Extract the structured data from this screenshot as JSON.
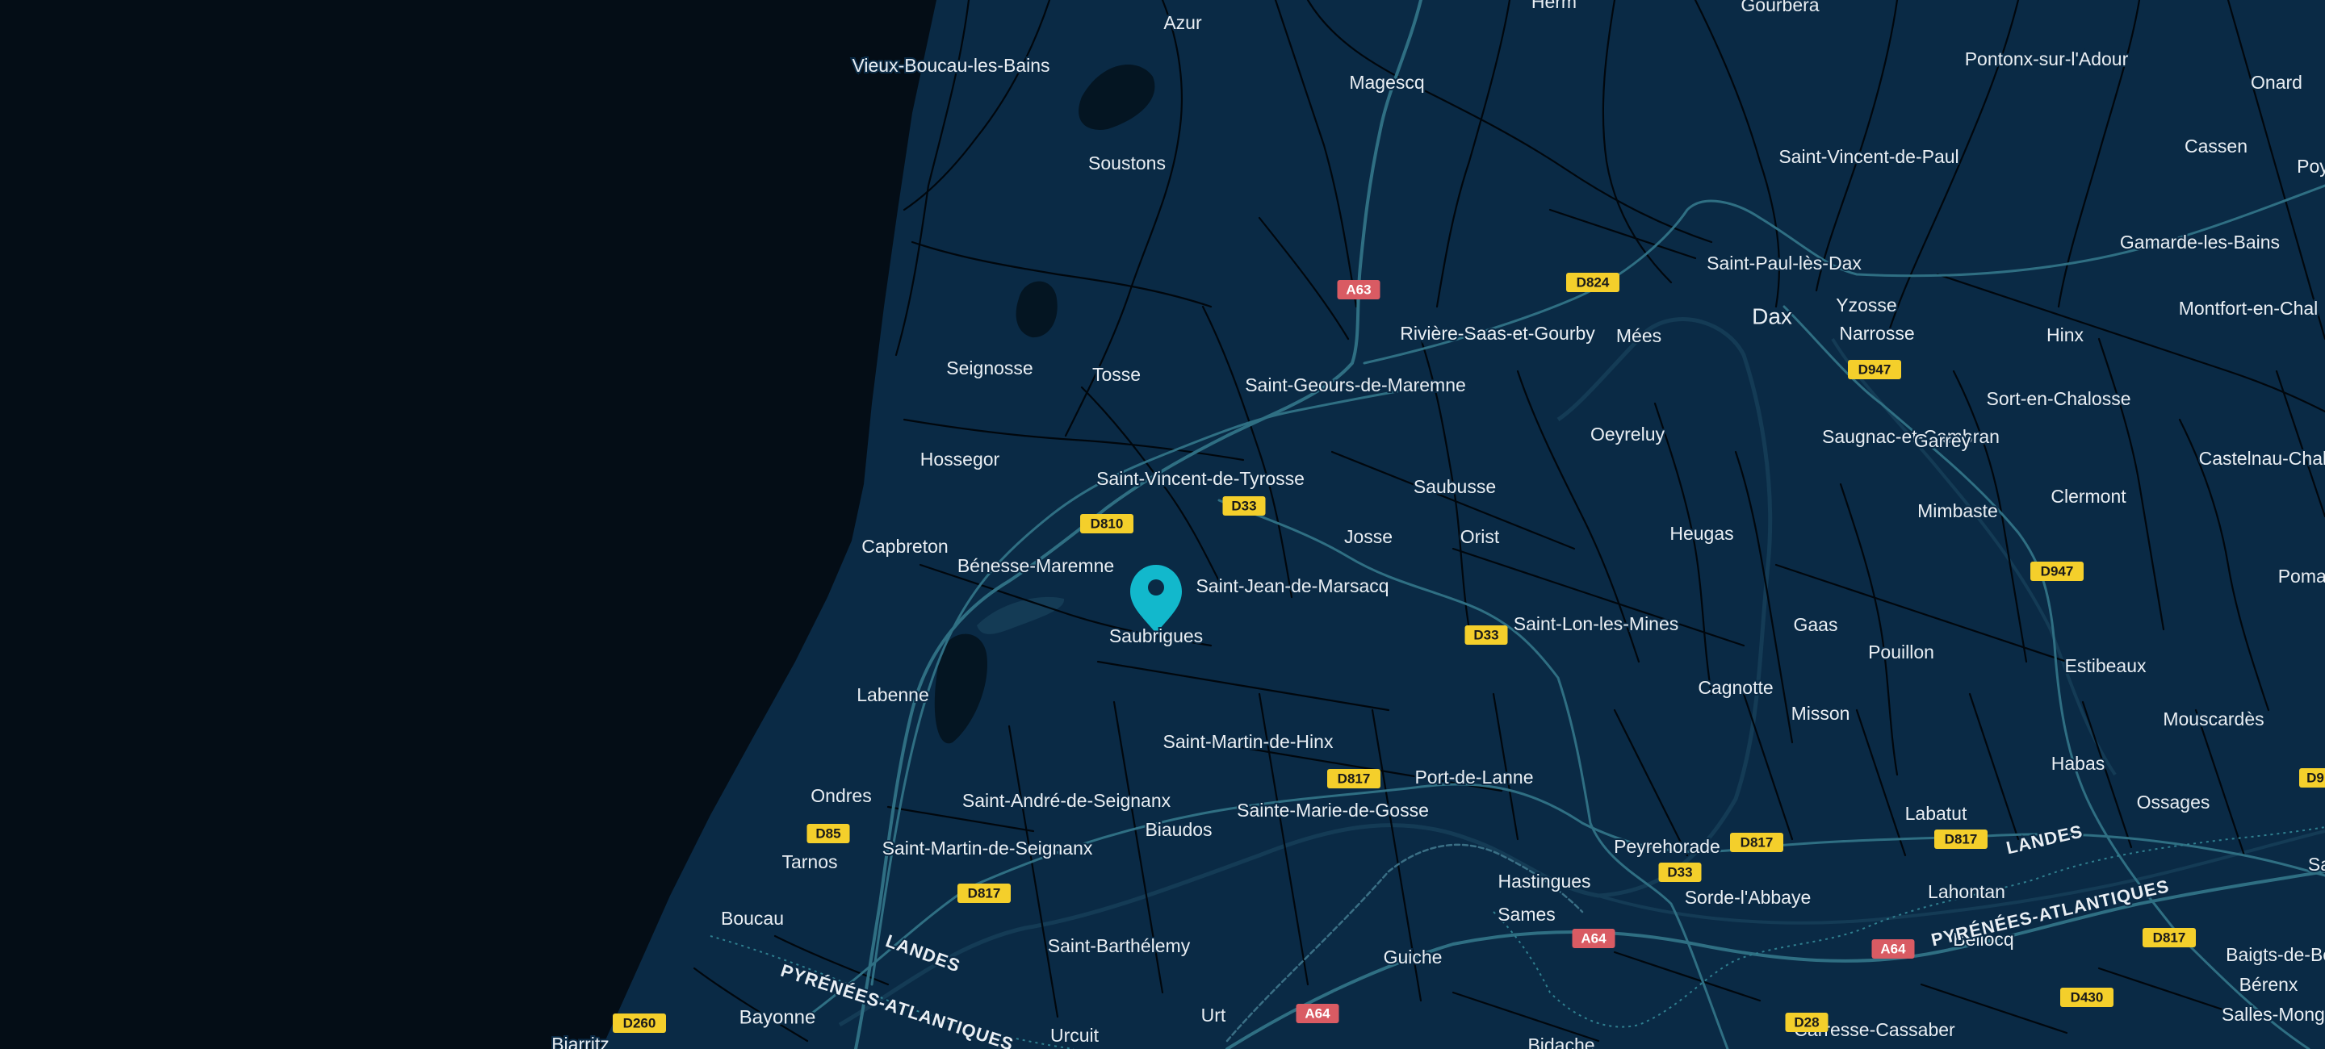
{
  "map": {
    "colors": {
      "ocean": "#040d16",
      "land": "#0a2a45",
      "road": "#01070d",
      "highway": "#2f6f83",
      "water": "#143b55",
      "pin": "#12b8cc",
      "d_shield": "#f4cf2b",
      "a_shield": "#d95b63"
    },
    "pin": {
      "icon": "map-pin-icon",
      "label": "Saubrigues"
    },
    "places": [
      {
        "name": "Herm"
      },
      {
        "name": "Gourbera"
      },
      {
        "name": "Azur"
      },
      {
        "name": "Pontonx-sur-l'Adour"
      },
      {
        "name": "Onard"
      },
      {
        "name": "Vieux-Boucau-les-Bains"
      },
      {
        "name": "Magescq"
      },
      {
        "name": "Cassen"
      },
      {
        "name": "Poy"
      },
      {
        "name": "Soustons"
      },
      {
        "name": "Saint-Vincent-de-Paul"
      },
      {
        "name": "Gamarde-les-Bains"
      },
      {
        "name": "Saint-Paul-lès-Dax"
      },
      {
        "name": "Dax"
      },
      {
        "name": "Yzosse"
      },
      {
        "name": "Montfort-en-Chal"
      },
      {
        "name": "Rivière-Saas-et-Gourby"
      },
      {
        "name": "Mées"
      },
      {
        "name": "Narrosse"
      },
      {
        "name": "Hinx"
      },
      {
        "name": "Seignosse"
      },
      {
        "name": "Tosse"
      },
      {
        "name": "Saint-Geours-de-Maremne"
      },
      {
        "name": "Sort-en-Chalosse"
      },
      {
        "name": "Oeyreluy"
      },
      {
        "name": "Saugnac-et-Cambran"
      },
      {
        "name": "Garrey"
      },
      {
        "name": "Castelnau-Chalos"
      },
      {
        "name": "Hossegor"
      },
      {
        "name": "Saint-Vincent-de-Tyrosse"
      },
      {
        "name": "Saubusse"
      },
      {
        "name": "Clermont"
      },
      {
        "name": "Mimbaste"
      },
      {
        "name": "Josse"
      },
      {
        "name": "Orist"
      },
      {
        "name": "Heugas"
      },
      {
        "name": "Capbreton"
      },
      {
        "name": "Bénesse-Maremne"
      },
      {
        "name": "Pomare"
      },
      {
        "name": "Saint-Jean-de-Marsacq"
      },
      {
        "name": "Saint-Lon-les-Mines"
      },
      {
        "name": "Gaas"
      },
      {
        "name": "Pouillon"
      },
      {
        "name": "Estibeaux"
      },
      {
        "name": "Labenne"
      },
      {
        "name": "Cagnotte"
      },
      {
        "name": "Misson"
      },
      {
        "name": "Mouscardès"
      },
      {
        "name": "Saint-Martin-de-Hinx"
      },
      {
        "name": "Habas"
      },
      {
        "name": "Port-de-Lanne"
      },
      {
        "name": "Ondres"
      },
      {
        "name": "Saint-André-de-Seignanx"
      },
      {
        "name": "Sainte-Marie-de-Gosse"
      },
      {
        "name": "Ossages"
      },
      {
        "name": "Labatut"
      },
      {
        "name": "Biaudos"
      },
      {
        "name": "Tarnos"
      },
      {
        "name": "Saint-Martin-de-Seignanx"
      },
      {
        "name": "Peyrehorade"
      },
      {
        "name": "Hastingues"
      },
      {
        "name": "Sorde-l'Abbaye"
      },
      {
        "name": "Lahontan"
      },
      {
        "name": "Boucau"
      },
      {
        "name": "Sames"
      },
      {
        "name": "Bellocq"
      },
      {
        "name": "Saint-Barthélemy"
      },
      {
        "name": "Guiche"
      },
      {
        "name": "Baigts-de-Béa"
      },
      {
        "name": "Bérenx"
      },
      {
        "name": "Bayonne"
      },
      {
        "name": "Urt"
      },
      {
        "name": "Salles-Mongisc"
      },
      {
        "name": "Urcuit"
      },
      {
        "name": "Carresse-Cassaber"
      },
      {
        "name": "Biarritz"
      },
      {
        "name": "Bidache"
      },
      {
        "name": "Sa"
      }
    ],
    "regions": [
      {
        "name": "LANDES"
      },
      {
        "name": "PYRÉNÉES-ATLANTIQUES"
      },
      {
        "name": "LANDES"
      },
      {
        "name": "PYRÉNÉES-ATLANTIQUES"
      }
    ],
    "shields": [
      {
        "label": "A63",
        "type": "A"
      },
      {
        "label": "D824",
        "type": "D"
      },
      {
        "label": "D947",
        "type": "D"
      },
      {
        "label": "D810",
        "type": "D"
      },
      {
        "label": "D33",
        "type": "D"
      },
      {
        "label": "D947",
        "type": "D"
      },
      {
        "label": "D33",
        "type": "D"
      },
      {
        "label": "D817",
        "type": "D"
      },
      {
        "label": "D85",
        "type": "D"
      },
      {
        "label": "D817",
        "type": "D"
      },
      {
        "label": "D817",
        "type": "D"
      },
      {
        "label": "D817",
        "type": "D"
      },
      {
        "label": "D33",
        "type": "D"
      },
      {
        "label": "A64",
        "type": "A"
      },
      {
        "label": "A64",
        "type": "A"
      },
      {
        "label": "D817",
        "type": "D"
      },
      {
        "label": "D430",
        "type": "D"
      },
      {
        "label": "D260",
        "type": "D"
      },
      {
        "label": "A64",
        "type": "A"
      },
      {
        "label": "D28",
        "type": "D"
      },
      {
        "label": "D9",
        "type": "D"
      }
    ]
  }
}
